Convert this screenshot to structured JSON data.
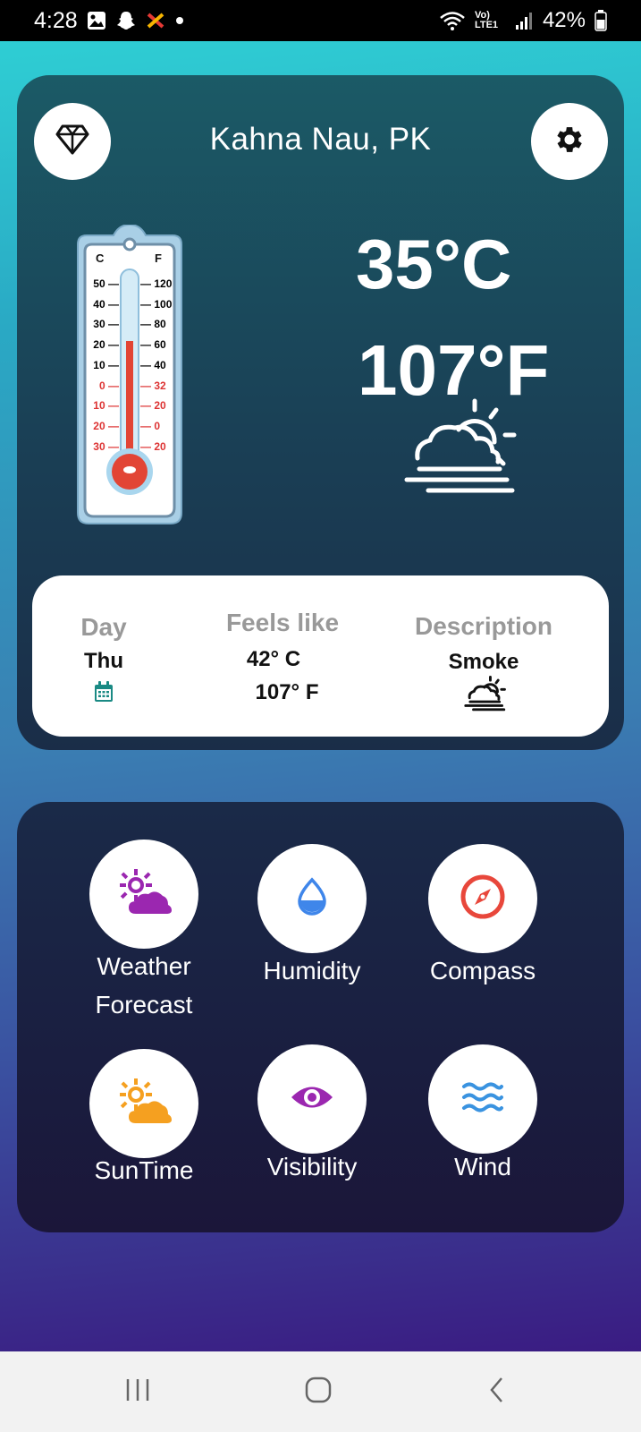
{
  "status_bar": {
    "time": "4:28",
    "battery": "42%",
    "network_label": "Vo) LTE1",
    "icons": [
      "gallery-icon",
      "snapchat-icon",
      "app-notification-icon",
      "dot-icon",
      "wifi-icon",
      "signal-icon",
      "battery-icon"
    ]
  },
  "header": {
    "location": "Kahna Nau, PK",
    "left_button_icon": "diamond-icon",
    "right_button_icon": "gear-icon"
  },
  "current": {
    "temp_c": "35°C",
    "temp_f": "107°F",
    "condition_icon": "sun-behind-cloud-haze-icon"
  },
  "thermometer": {
    "units": [
      "C",
      "F"
    ],
    "celsius_ticks": [
      "50",
      "40",
      "30",
      "20",
      "10",
      "0",
      "10",
      "20",
      "30"
    ],
    "fahrenheit_ticks": [
      "120",
      "100",
      "80",
      "60",
      "40",
      "32",
      "20",
      "0",
      "20"
    ]
  },
  "info": {
    "day_label": "Day",
    "day_value": "Thu",
    "feels_label": "Feels like",
    "feels_c": "42° C",
    "feels_f": "107° F",
    "desc_label": "Description",
    "desc_value": "Smoke"
  },
  "tiles": [
    {
      "label_line1": "Weather",
      "label_line2": "Forecast",
      "icon": "sun-cloud-purple-icon"
    },
    {
      "label": "Humidity",
      "icon": "water-drop-icon"
    },
    {
      "label": "Compass",
      "icon": "compass-icon"
    },
    {
      "label": "SunTime",
      "icon": "sun-cloud-orange-icon"
    },
    {
      "label": "Visibility",
      "icon": "eye-icon"
    },
    {
      "label": "Wind",
      "icon": "waves-icon"
    }
  ],
  "colors": {
    "purple": "#9b27b0",
    "blue_drop": "#3f86ea",
    "compass_red": "#e8473b",
    "orange": "#f5a020",
    "wind_blue": "#3a93e0",
    "calendar_teal": "#1a8a84"
  },
  "nav": {
    "buttons": [
      "recents-icon",
      "home-icon",
      "back-icon"
    ]
  }
}
